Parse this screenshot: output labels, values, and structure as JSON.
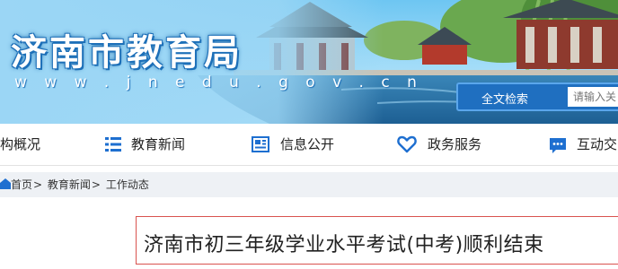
{
  "header": {
    "site_title": "济南市教育局",
    "site_url": "w w w . j n e d u . g o v . c n"
  },
  "search": {
    "button_label": "全文检索",
    "placeholder": "请输入关"
  },
  "nav": {
    "items": [
      {
        "label": "构概况",
        "icon": "partial"
      },
      {
        "label": "教育新闻",
        "icon": "list-icon"
      },
      {
        "label": "信息公开",
        "icon": "newspaper-icon"
      },
      {
        "label": "政务服务",
        "icon": "heart-icon"
      },
      {
        "label": "互动交",
        "icon": "chat-icon"
      }
    ]
  },
  "breadcrumb": {
    "items": [
      "首页",
      "教育新闻",
      "工作动态"
    ],
    "separator": ">"
  },
  "article": {
    "title": "济南市初三年级学业水平考试(中考)顺利结束"
  },
  "colors": {
    "nav_icon": "#1e6fd0",
    "search_bg": "#1f6fc0",
    "title_border": "#d9534f",
    "crumb_bg": "#eef1f5"
  }
}
